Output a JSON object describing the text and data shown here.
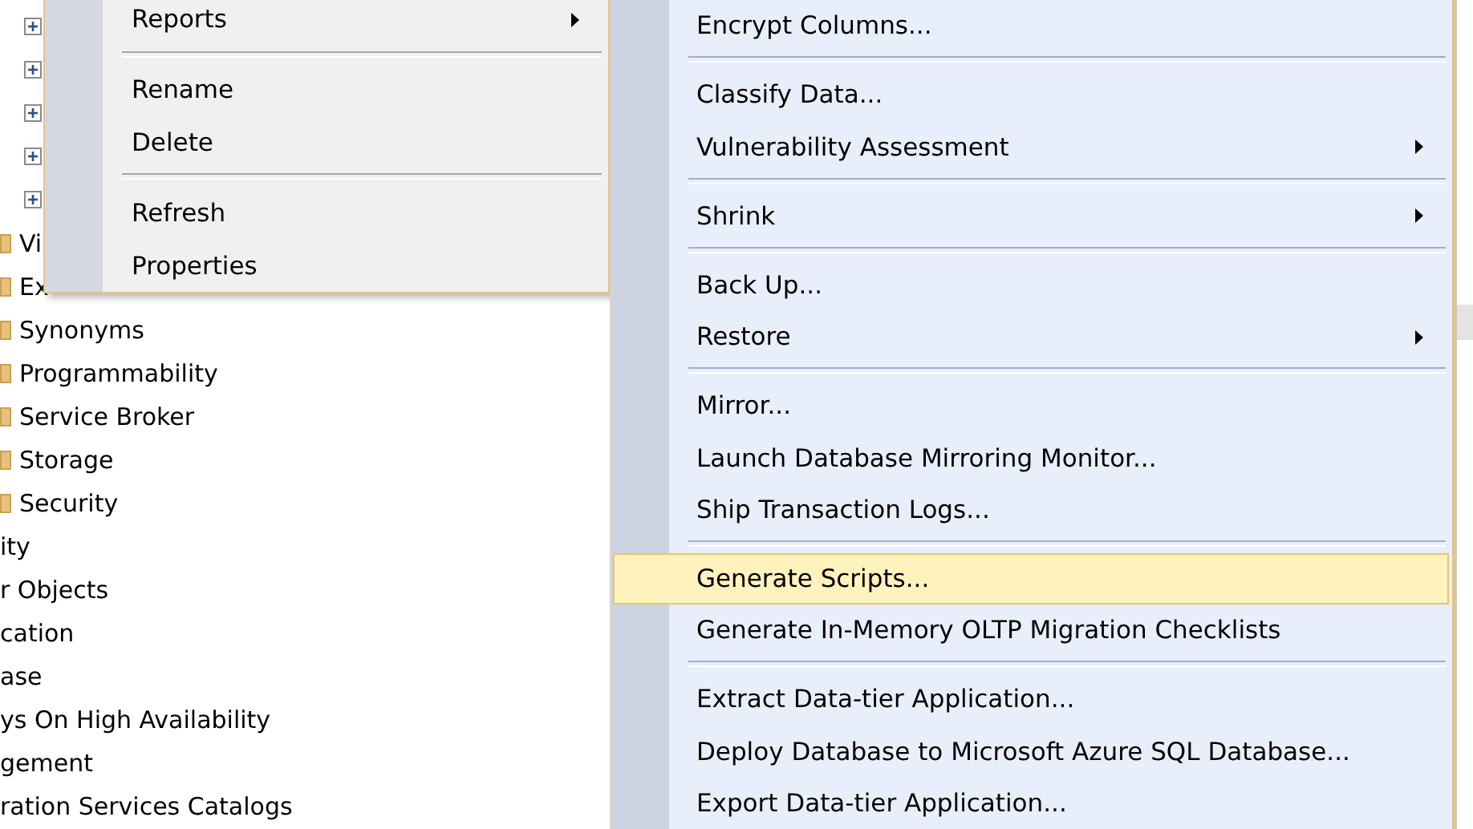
{
  "tree": {
    "rows": [
      {
        "kind": "expander",
        "expanded": false
      },
      {
        "kind": "expander",
        "expanded": false
      },
      {
        "kind": "expander",
        "expanded": false
      },
      {
        "kind": "expander",
        "expanded": false
      },
      {
        "kind": "expander",
        "expanded": false
      },
      {
        "kind": "folder",
        "label": "Vi"
      },
      {
        "kind": "folder",
        "label": "Ex"
      },
      {
        "kind": "folder",
        "label": "Synonyms"
      },
      {
        "kind": "folder",
        "label": "Programmability"
      },
      {
        "kind": "folder",
        "label": "Service Broker"
      },
      {
        "kind": "folder",
        "label": "Storage"
      },
      {
        "kind": "folder",
        "label": "Security"
      },
      {
        "kind": "text",
        "label": "ity"
      },
      {
        "kind": "text",
        "label": "r Objects"
      },
      {
        "kind": "text",
        "label": "cation"
      },
      {
        "kind": "text",
        "label": "ase"
      },
      {
        "kind": "text",
        "label": "ys On High Availability"
      },
      {
        "kind": "text",
        "label": "gement"
      },
      {
        "kind": "text",
        "label": "ration Services Catalogs"
      }
    ]
  },
  "context_menu": {
    "groups": [
      [
        {
          "label": "Reports",
          "submenu": true,
          "selected": false
        }
      ],
      [
        {
          "label": "Rename",
          "submenu": false,
          "selected": false
        },
        {
          "label": "Delete",
          "submenu": false,
          "selected": false
        }
      ],
      [
        {
          "label": "Refresh",
          "submenu": false,
          "selected": false
        },
        {
          "label": "Properties",
          "submenu": false,
          "selected": false
        }
      ]
    ]
  },
  "tasks_submenu": {
    "groups": [
      [
        {
          "label": "Encrypt Columns...",
          "submenu": false,
          "selected": false
        }
      ],
      [
        {
          "label": "Classify Data...",
          "submenu": false,
          "selected": false
        },
        {
          "label": "Vulnerability Assessment",
          "submenu": true,
          "selected": false
        }
      ],
      [
        {
          "label": "Shrink",
          "submenu": true,
          "selected": false
        }
      ],
      [
        {
          "label": "Back Up...",
          "submenu": false,
          "selected": false
        },
        {
          "label": "Restore",
          "submenu": true,
          "selected": false
        }
      ],
      [
        {
          "label": "Mirror...",
          "submenu": false,
          "selected": false
        },
        {
          "label": "Launch Database Mirroring Monitor...",
          "submenu": false,
          "selected": false
        },
        {
          "label": "Ship Transaction Logs...",
          "submenu": false,
          "selected": false
        }
      ],
      [
        {
          "label": "Generate Scripts...",
          "submenu": false,
          "selected": true
        },
        {
          "label": "Generate In-Memory OLTP Migration Checklists",
          "submenu": false,
          "selected": false
        }
      ],
      [
        {
          "label": "Extract Data-tier Application...",
          "submenu": false,
          "selected": false
        },
        {
          "label": "Deploy Database to Microsoft Azure SQL Database...",
          "submenu": false,
          "selected": false
        },
        {
          "label": "Export Data-tier Application...",
          "submenu": false,
          "selected": false
        }
      ]
    ]
  }
}
